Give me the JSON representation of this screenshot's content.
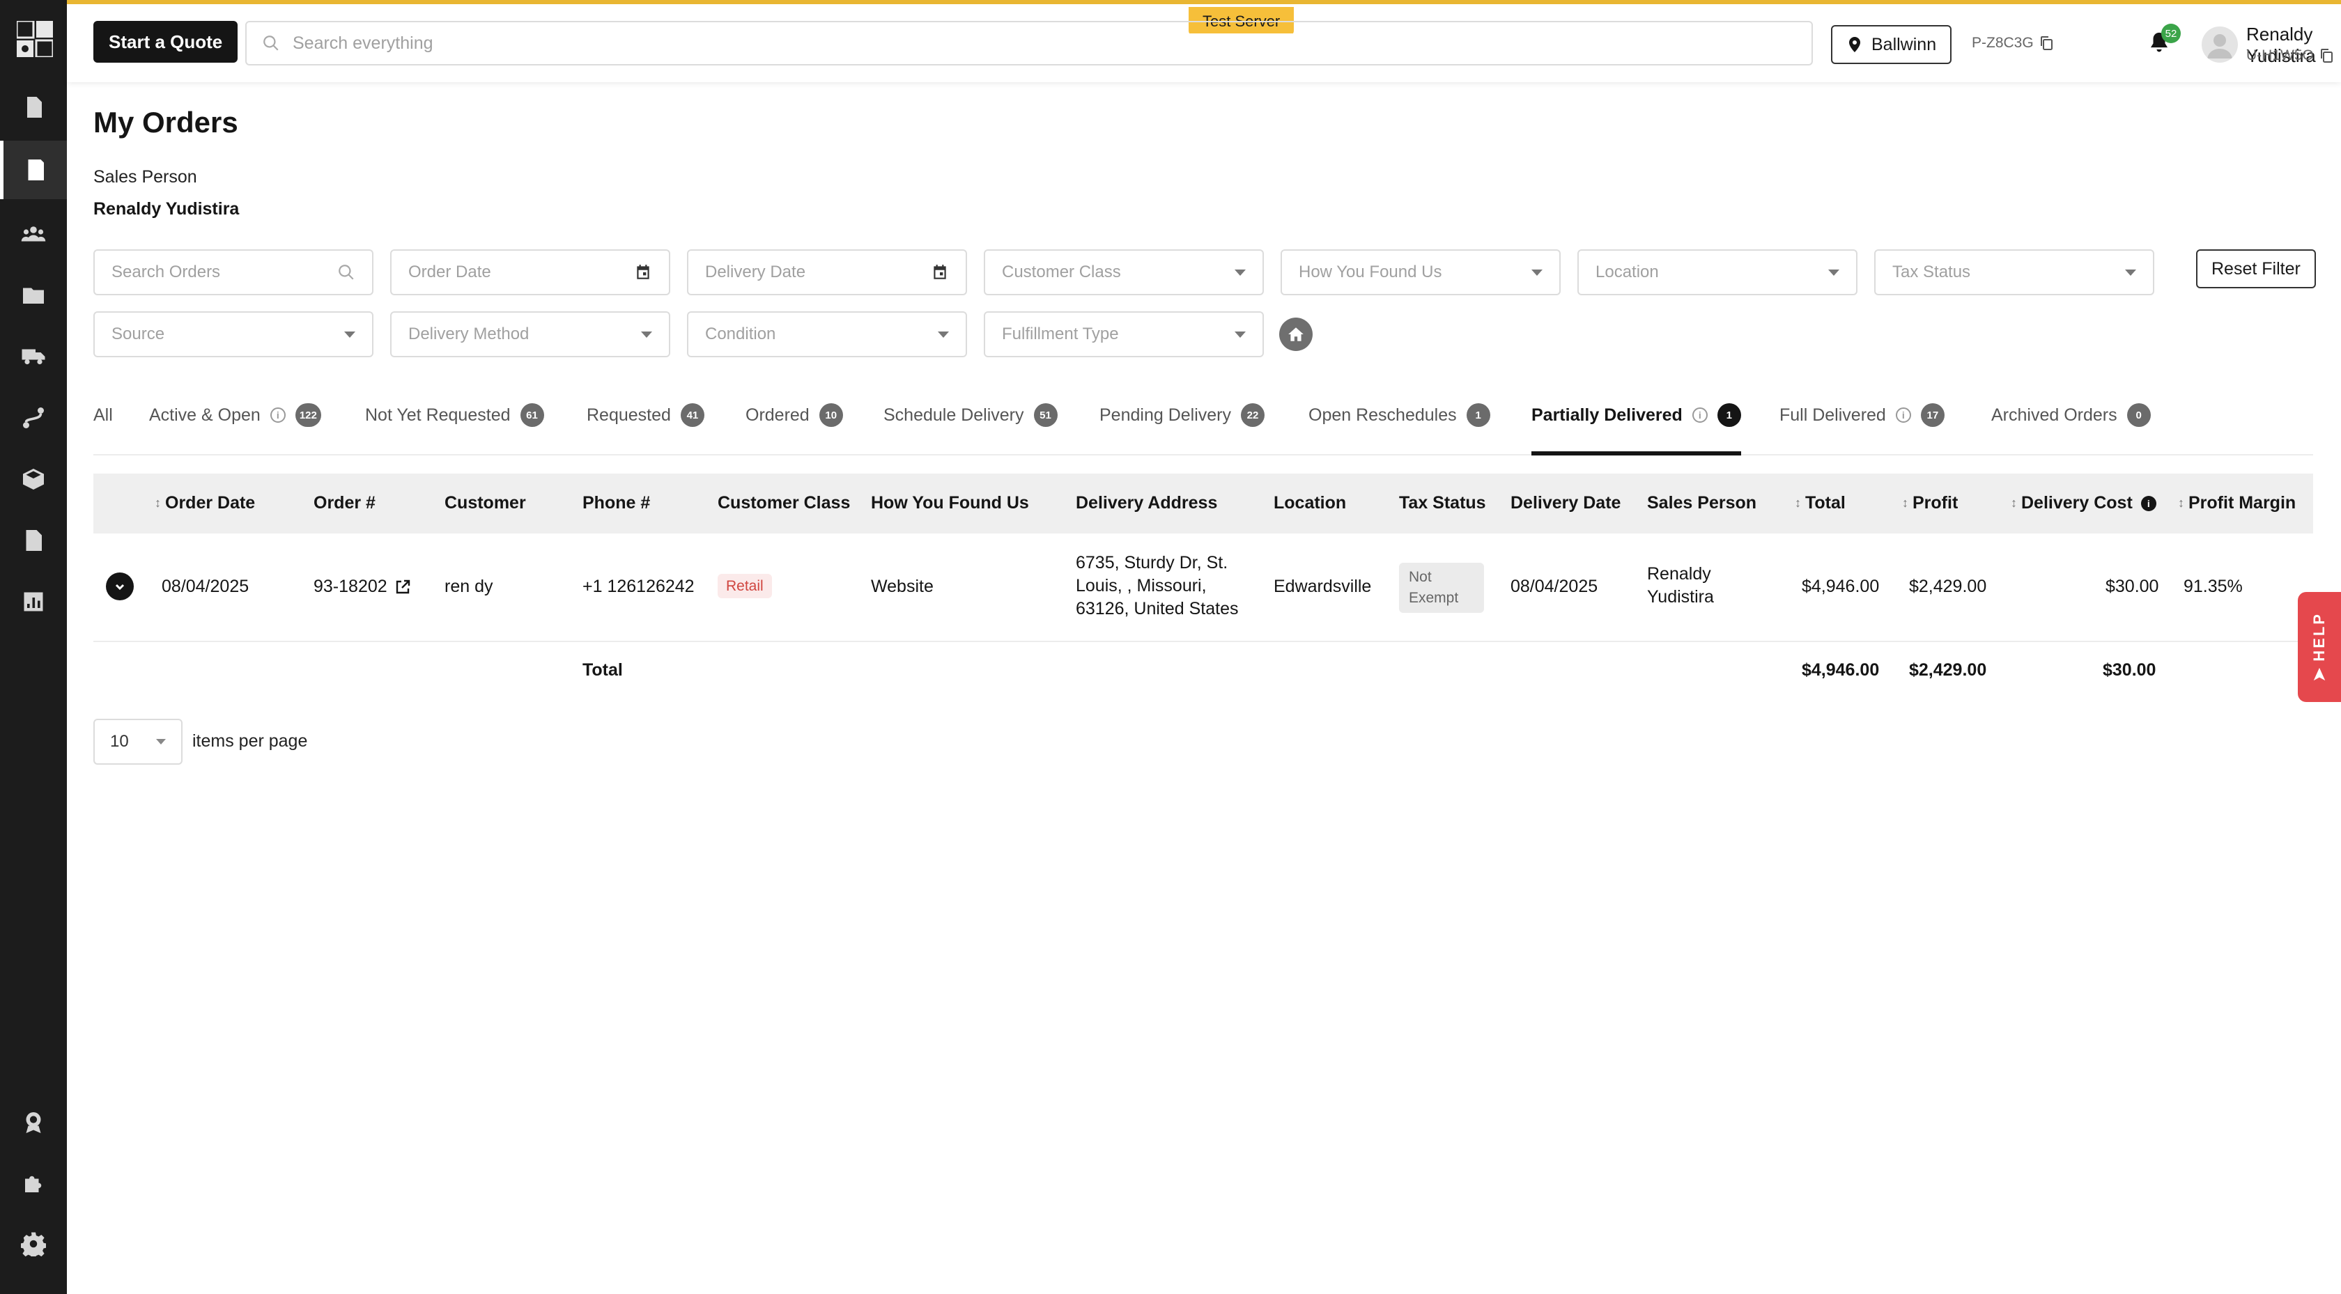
{
  "top": {
    "server_badge": "Test Server",
    "quote_button": "Start a Quote",
    "search_placeholder": "Search everything",
    "location": "Ballwinn",
    "project_id": "P-Z8C3G",
    "notifications_count": "52",
    "user_name": "Renaldy Yudistira",
    "user_id": "U-H1W5O"
  },
  "sidebar": {
    "items": [
      {
        "icon": "dollar-doc-icon"
      },
      {
        "icon": "orders-doc-icon",
        "active": true
      },
      {
        "icon": "people-icon"
      },
      {
        "icon": "folder-icon"
      },
      {
        "icon": "truck-icon"
      },
      {
        "icon": "route-icon"
      },
      {
        "icon": "box-icon"
      },
      {
        "icon": "document-icon"
      },
      {
        "icon": "bar-chart-icon"
      },
      {
        "icon": "badge-icon"
      },
      {
        "icon": "puzzle-icon"
      },
      {
        "icon": "gear-icon"
      }
    ]
  },
  "page": {
    "title": "My Orders",
    "sales_person_label": "Sales Person",
    "sales_person_value": "Renaldy Yudistira"
  },
  "filters": {
    "search_orders": "Search Orders",
    "order_date": "Order Date",
    "delivery_date": "Delivery Date",
    "customer_class": "Customer Class",
    "how_found": "How You Found Us",
    "location": "Location",
    "tax_status": "Tax Status",
    "source": "Source",
    "delivery_method": "Delivery Method",
    "condition": "Condition",
    "fulfillment_type": "Fulfillment Type",
    "reset": "Reset Filter"
  },
  "tabs": [
    {
      "label": "All"
    },
    {
      "label": "Active & Open",
      "count": "122"
    },
    {
      "label": "Not Yet Requested",
      "count": "61"
    },
    {
      "label": "Requested",
      "count": "41"
    },
    {
      "label": "Ordered",
      "count": "10"
    },
    {
      "label": "Schedule Delivery",
      "count": "51"
    },
    {
      "label": "Pending Delivery",
      "count": "22"
    },
    {
      "label": "Open Reschedules",
      "count": "1"
    },
    {
      "label": "Partially Delivered",
      "count": "1",
      "active": true
    },
    {
      "label": "Full Delivered",
      "count": "17"
    },
    {
      "label": "Archived Orders",
      "count": "0"
    }
  ],
  "table": {
    "columns": [
      "Order Date",
      "Order #",
      "Customer",
      "Phone #",
      "Customer Class",
      "How You Found Us",
      "Delivery Address",
      "Location",
      "Tax Status",
      "Delivery Date",
      "Sales Person",
      "Total",
      "Profit",
      "Delivery Cost",
      "Profit Margin"
    ],
    "rows": [
      {
        "order_date": "08/04/2025",
        "order_no": "93-18202",
        "customer": "ren dy",
        "phone": "+1 126126242",
        "customer_class": "Retail",
        "how_found": "Website",
        "address_line1": "6735, Sturdy Dr, St.",
        "address_line2": "Louis, , Missouri,",
        "address_line3": "63126, United States",
        "location": "Edwardsville",
        "tax_line1": "Not",
        "tax_line2": "Exempt",
        "delivery_date": "08/04/2025",
        "sales_line1": "Renaldy",
        "sales_line2": "Yudistira",
        "total": "$4,946.00",
        "profit": "$2,429.00",
        "delivery_cost": "$30.00",
        "profit_margin": "91.35%"
      }
    ],
    "footer": {
      "label": "Total",
      "total": "$4,946.00",
      "profit": "$2,429.00",
      "delivery_cost": "$30.00"
    }
  },
  "pagination": {
    "per_page": "10",
    "label": "items per page"
  },
  "help": {
    "label": "HELP"
  }
}
